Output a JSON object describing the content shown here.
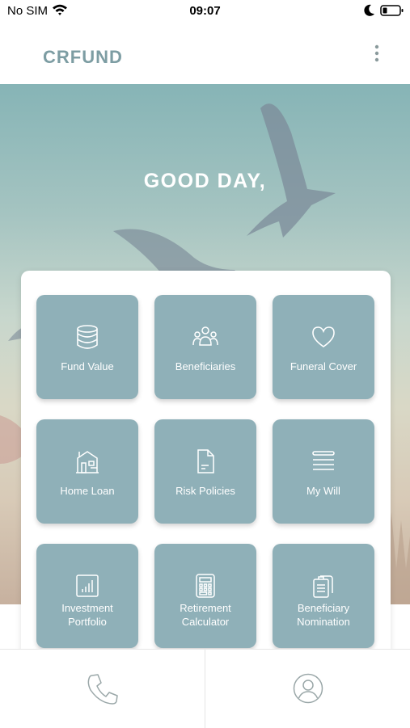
{
  "status_bar": {
    "carrier": "No SIM",
    "time": "09:07"
  },
  "header": {
    "title": "CRFUND",
    "more_icon": "more-vertical-icon"
  },
  "hero": {
    "greeting": "GOOD DAY,"
  },
  "tiles": [
    {
      "label": "Fund Value",
      "icon": "coins-stack-icon"
    },
    {
      "label": "Beneficiaries",
      "icon": "people-group-icon"
    },
    {
      "label": "Funeral Cover",
      "icon": "heart-icon"
    },
    {
      "label": "Home Loan",
      "icon": "house-icon"
    },
    {
      "label": "Risk Policies",
      "icon": "document-icon"
    },
    {
      "label": "My Will",
      "icon": "list-lines-icon"
    },
    {
      "label": "Investment\nPortfolio",
      "icon": "bar-chart-icon"
    },
    {
      "label": "Retirement\nCalculator",
      "icon": "calculator-icon"
    },
    {
      "label": "Beneficiary\nNomination",
      "icon": "clipboard-icon"
    }
  ],
  "bottom_nav": {
    "left_icon": "phone-icon",
    "right_icon": "user-profile-icon"
  },
  "colors": {
    "brand": "#7d9da3",
    "tile": "#8fb0b8"
  }
}
